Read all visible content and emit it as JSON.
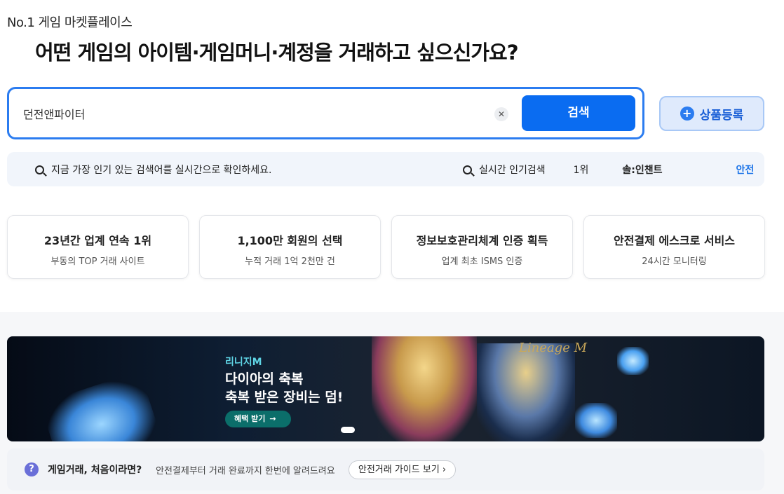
{
  "header": {
    "tagline": "No.1 게임 마켓플레이스",
    "headline": "어떤 게임의 아이템·게임머니·계정을 거래하고 싶으신가요?"
  },
  "search": {
    "value": "던전앤파이터",
    "clear_label": "✕",
    "button_label": "검색"
  },
  "register": {
    "plus": "+",
    "label": "상품등록"
  },
  "trending": {
    "prompt": "지금 가장 인기 있는 검색어를 실시간으로 확인하세요.",
    "label": "실시간 인기검색",
    "rank": "1위",
    "keyword": "솔:인챈트",
    "badge": "안전"
  },
  "stats": [
    {
      "title": "23년간 업계 연속 1위",
      "sub": "부동의 TOP 거래 사이트"
    },
    {
      "title": "1,100만 회원의 선택",
      "sub": "누적 거래 1억 2천만 건"
    },
    {
      "title": "정보보호관리체계 인증 획득",
      "sub": "업계 최초 ISMS 인증"
    },
    {
      "title": "안전결제 에스크로 서비스",
      "sub": "24시간 모니터링"
    }
  ],
  "banner": {
    "tag": "리니지M",
    "title_line1": "다이아의 축복",
    "title_line2": "축복 받은 장비는 덤!",
    "cta": "혜택 받기",
    "cta_arrow": "→",
    "logo_text": "Lineage M"
  },
  "guide": {
    "icon": "?",
    "question": "게임거래, 처음이라면?",
    "description": "안전결제부터 거래 완료까지 한번에 알려드려요",
    "button": "안전거래 가이드 보기 ›"
  },
  "colors": {
    "accent": "#0a6cf1",
    "search_border": "#2b7cf0",
    "trend_bg": "#f1f5fb",
    "safe_text": "#1a73e8"
  }
}
